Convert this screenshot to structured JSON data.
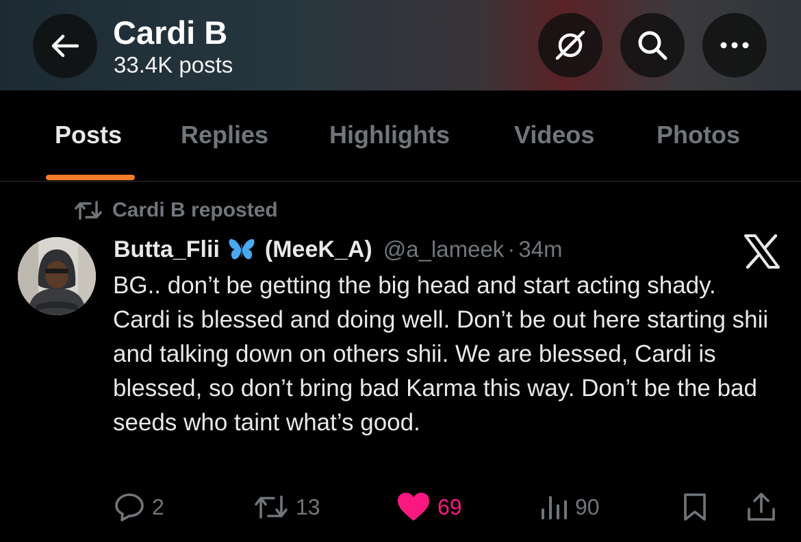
{
  "header": {
    "title": "Cardi B",
    "post_count": "33.4K posts",
    "icons": [
      "back-arrow-icon",
      "grok-icon",
      "search-icon",
      "more-icon"
    ]
  },
  "tabs": [
    {
      "label": "Posts",
      "active": true
    },
    {
      "label": "Replies",
      "active": false
    },
    {
      "label": "Highlights",
      "active": false
    },
    {
      "label": "Videos",
      "active": false
    },
    {
      "label": "Photos",
      "active": false
    }
  ],
  "colors": {
    "accent": "#f47a2c",
    "like": "#f91880",
    "muted": "#71767b",
    "butterfly": "#4aa8f0"
  },
  "post": {
    "repost_label": "Cardi B reposted",
    "author_name": "Butta_Flii",
    "author_name_suffix": "(MeeK_A)",
    "handle": "@a_lameek",
    "separator": "·",
    "time": "34m",
    "text": "BG.. don’t be getting the big head and start acting shady. Cardi is blessed and doing well. Don’t be out here starting shii and talking down on others shii. We are blessed, Cardi is blessed, so don’t bring bad Karma this way. Don’t be the bad seeds who taint what’s good.",
    "stats": {
      "replies": "2",
      "reposts": "13",
      "likes": "69",
      "views": "90"
    },
    "liked": true
  }
}
